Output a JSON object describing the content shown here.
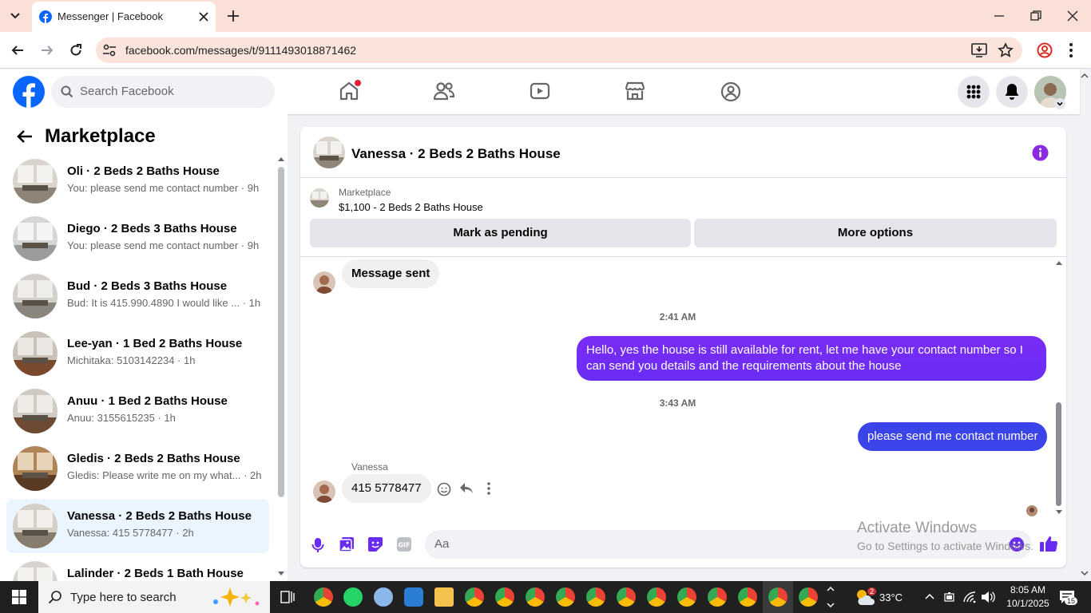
{
  "browser": {
    "tab_title": "Messenger | Facebook",
    "url": "facebook.com/messages/t/9111493018871462"
  },
  "fb_header": {
    "search_placeholder": "Search Facebook"
  },
  "sidebar": {
    "title": "Marketplace",
    "conversations": [
      {
        "name": "Oli · 2 Beds 2 Baths House",
        "preview": "You: please send me contact number · 9h"
      },
      {
        "name": "Diego · 2 Beds 3 Baths House",
        "preview": "You: please send me contact number · 9h"
      },
      {
        "name": "Bud · 2 Beds 3 Baths House",
        "preview": "Bud: It is 415.990.4890 I would like ... · 1h"
      },
      {
        "name": "Lee-yan · 1 Bed 2 Baths House",
        "preview": "Michitaka: 5103142234 · 1h"
      },
      {
        "name": "Anuu · 1 Bed 2 Baths House",
        "preview": "Anuu: 3155615235 · 1h"
      },
      {
        "name": "Gledis · 2 Beds 2 Baths House",
        "preview": "Gledis: Please write me on my what... · 2h"
      },
      {
        "name": "Vanessa · 2 Beds 2 Baths House",
        "preview": "Vanessa: 415 5778477 · 2h"
      },
      {
        "name": "Lalinder · 2 Beds 1 Bath House",
        "preview": ""
      }
    ]
  },
  "chat": {
    "title": "Vanessa · 2 Beds 2 Baths House",
    "marketplace_label": "Marketplace",
    "listing": "$1,100 - 2 Beds 2 Baths House",
    "mark_pending_label": "Mark as pending",
    "more_options_label": "More options",
    "messages": [
      {
        "text": "Message sent"
      },
      {
        "time": "2:41 AM"
      },
      {
        "text": "Hello, yes the house is still available for rent, let me have your contact number so I can send you details and the requirements about the house"
      },
      {
        "time": "3:43 AM"
      },
      {
        "text": "please send me contact number"
      },
      {
        "sender": "Vanessa",
        "text": "415 5778477"
      }
    ],
    "composer_placeholder": "Aa"
  },
  "watermark": {
    "line1": "Activate Windows",
    "line2": "Go to Settings to activate Windows."
  },
  "taskbar": {
    "search_placeholder": "Type here to search",
    "weather_temp": "33°C",
    "weather_badge": "2",
    "time": "8:05 AM",
    "date": "10/1/2025",
    "notifications": "15"
  },
  "colors": {
    "fb_blue": "#0866ff",
    "messenger_purple": "#6a2cf5",
    "selected_conversation": "#ebf5ff"
  }
}
